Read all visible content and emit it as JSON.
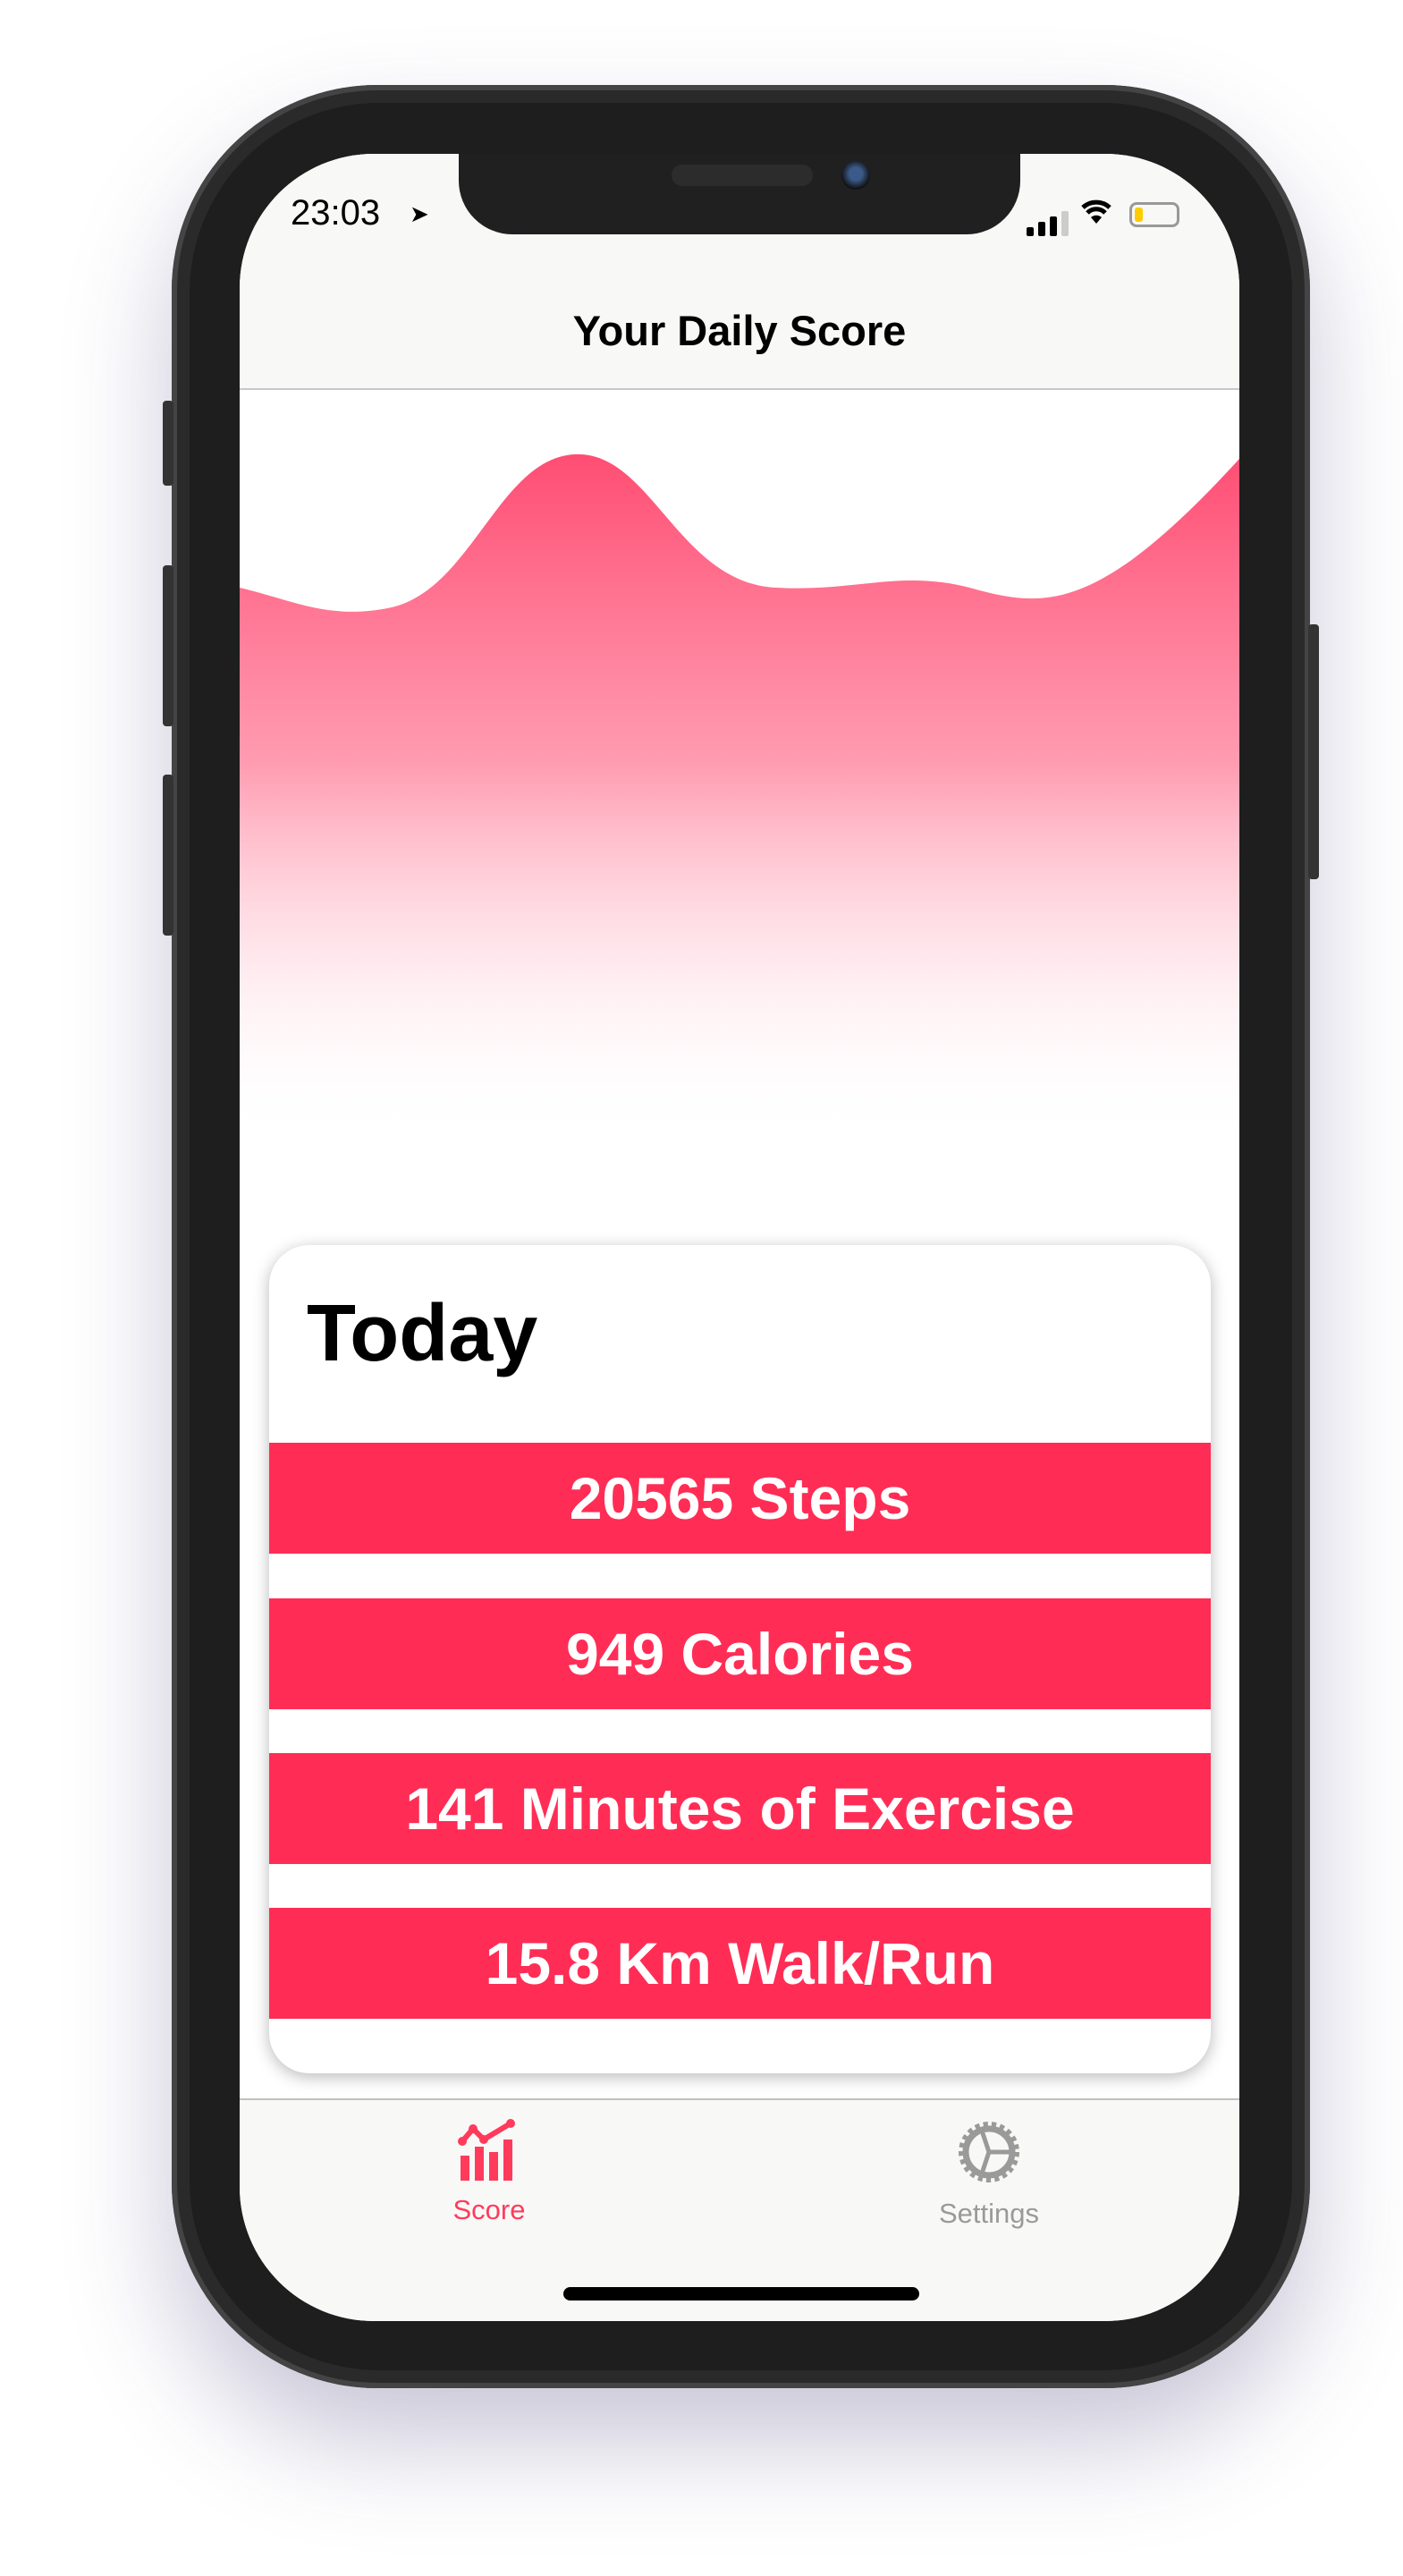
{
  "status_bar": {
    "time": "23:03",
    "location_icon": "location-arrow-icon",
    "signal_icon": "cellular-signal-icon",
    "wifi_icon": "wifi-icon",
    "battery_icon": "battery-low-icon",
    "battery_color": "#ffcc00"
  },
  "navbar": {
    "title": "Your Daily Score"
  },
  "chart_area": {
    "gradient_color": "#ff4d73"
  },
  "card": {
    "title": "Today",
    "stats": [
      {
        "label": "20565 Steps"
      },
      {
        "label": "949 Calories"
      },
      {
        "label": "141 Minutes of Exercise"
      },
      {
        "label": "15.8 Km Walk/Run"
      }
    ],
    "accent": "#ff2d55"
  },
  "tabbar": {
    "tabs": [
      {
        "label": "Score",
        "icon": "chart-icon",
        "active": true,
        "color": "#ff3b5c"
      },
      {
        "label": "Settings",
        "icon": "gear-icon",
        "active": false,
        "color": "#9a9a9a"
      }
    ]
  }
}
